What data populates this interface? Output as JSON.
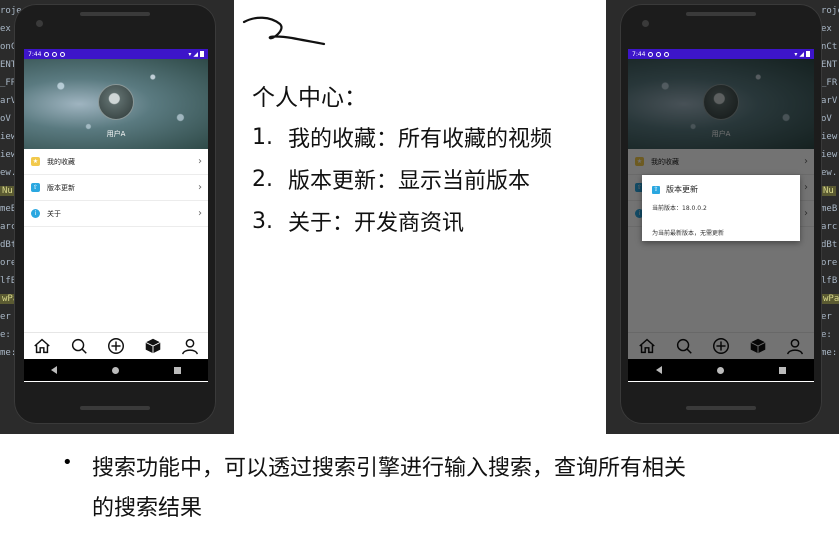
{
  "ide_left_lines": [
    {
      "text": "roje",
      "hl": false
    },
    {
      "text": "ex",
      "hl": false
    },
    {
      "text": "onC",
      "hl": false
    },
    {
      "text": "ENT",
      "hl": false
    },
    {
      "text": "_FR",
      "hl": false
    },
    {
      "text": "arV",
      "hl": false
    },
    {
      "text": "oV",
      "hl": false
    },
    {
      "text": "iew",
      "hl": false
    },
    {
      "text": "iew",
      "hl": false
    },
    {
      "text": "ew.",
      "hl": false
    },
    {
      "text": "Nu",
      "hl": true
    },
    {
      "text": "meB",
      "hl": false
    },
    {
      "text": "arc",
      "hl": false
    },
    {
      "text": "dBt",
      "hl": false
    },
    {
      "text": "ore",
      "hl": false
    },
    {
      "text": "lfB",
      "hl": false
    },
    {
      "text": "wPa",
      "hl": true
    },
    {
      "text": "er",
      "hl": false
    },
    {
      "text": "e:",
      "hl": false
    },
    {
      "text": "me:",
      "hl": false
    }
  ],
  "ide_right_lines": [
    {
      "text": "rojc",
      "hl": false
    },
    {
      "text": "ex",
      "hl": false
    },
    {
      "text": "nCt",
      "hl": false
    },
    {
      "text": "ENT",
      "hl": false
    },
    {
      "text": "_FR",
      "hl": false
    },
    {
      "text": "arV",
      "hl": false
    },
    {
      "text": "oV",
      "hl": false
    },
    {
      "text": "iew",
      "hl": false
    },
    {
      "text": "iew",
      "hl": false
    },
    {
      "text": "ew.",
      "hl": false
    },
    {
      "text": "Nu",
      "hl": true
    },
    {
      "text": "meB",
      "hl": false
    },
    {
      "text": "arc",
      "hl": false
    },
    {
      "text": "dBt",
      "hl": false
    },
    {
      "text": "ore",
      "hl": false
    },
    {
      "text": "lfB",
      "hl": false
    },
    {
      "text": "wPa",
      "hl": true
    },
    {
      "text": "er",
      "hl": false
    },
    {
      "text": "e:",
      "hl": false
    },
    {
      "text": "me:",
      "hl": false
    }
  ],
  "phone": {
    "status_time": "7:44",
    "username": "用户A",
    "menu": [
      {
        "label": "我的收藏",
        "icon": "star-icon",
        "color": "#f2c94c",
        "glyph": "★"
      },
      {
        "label": "版本更新",
        "icon": "upload-icon",
        "color": "#2aa7e0",
        "glyph": "⇧"
      },
      {
        "label": "关于",
        "icon": "info-icon",
        "color": "#2aa7e0",
        "glyph": "i"
      }
    ],
    "tabs": [
      "home-icon",
      "search-icon",
      "add-icon",
      "cube-icon",
      "profile-icon"
    ]
  },
  "dialog": {
    "title": "版本更新",
    "current_version": "当前版本：18.0.0.2",
    "message": "为当前最新版本，无需更新"
  },
  "slide": {
    "heading": "个人中心：",
    "items": [
      {
        "num": "1.",
        "text": "我的收藏：所有收藏的视频"
      },
      {
        "num": "2.",
        "text": "版本更新：显示当前版本"
      },
      {
        "num": "3.",
        "text": "关于：开发商资讯"
      }
    ],
    "bullet_line1": "搜索功能中，可以透过搜索引擎进行输入搜索，查询所有相关",
    "bullet_line2": "的搜索结果",
    "bullet": "•"
  },
  "colors": {
    "status_bar": "#3d15c9",
    "ide_bg": "#2b2b2b",
    "highlight": "#5b5b32"
  }
}
